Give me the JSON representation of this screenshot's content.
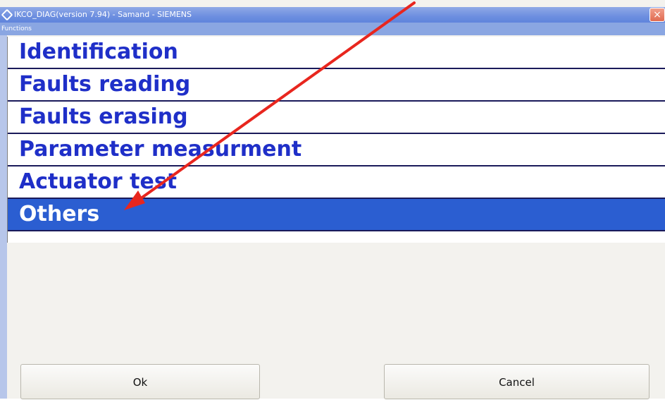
{
  "window": {
    "title": "IKCO_DIAG(version 7.94) - Samand - SIEMENS",
    "close_label": "×"
  },
  "panel": {
    "header": "Functions"
  },
  "functions": [
    {
      "label": "Identification",
      "selected": false
    },
    {
      "label": "Faults reading",
      "selected": false
    },
    {
      "label": "Faults erasing",
      "selected": false
    },
    {
      "label": "Parameter measurment",
      "selected": false
    },
    {
      "label": "Actuator test",
      "selected": false
    },
    {
      "label": "Others",
      "selected": true
    }
  ],
  "buttons": {
    "ok": "Ok",
    "cancel": "Cancel"
  },
  "colors": {
    "selection": "#2b5ed1",
    "item_text": "#1f2fc8",
    "annotation_arrow": "#e8261e"
  }
}
